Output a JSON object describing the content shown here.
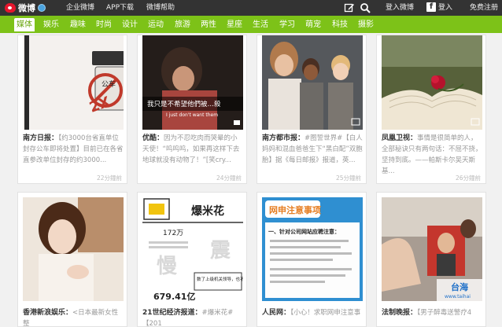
{
  "topbar": {
    "logo_text": "微博",
    "nav": [
      "企业微博",
      "APP下载",
      "微博帮助"
    ],
    "login_weibo": "登入微博",
    "login_fb": "登入",
    "register": "免费注册",
    "fb_letter": "f"
  },
  "categories": [
    "媒体",
    "娱乐",
    "趣味",
    "时尚",
    "设计",
    "运动",
    "旅游",
    "两性",
    "星座",
    "生活",
    "学习",
    "萌宠",
    "科技",
    "摄影"
  ],
  "cards_row1": [
    {
      "source": "南方日报：",
      "text": "【约3000台省直单位封存公车即将处置】目前已在各省直参改单位封存的约3000...",
      "time": "22分鐘前"
    },
    {
      "source": "优酷：",
      "text": "因为不忍吃肉而哭晕的小天使！“呜呜呜，如果再这样下去地球就没有动物了！”[笑cry...",
      "time": "24分鐘前"
    },
    {
      "source": "南方都市报：",
      "text": "#图誓世界#【白人妈妈和混血爸爸生下“黑白配”双胞胎】据《每日邮报》报道，英...",
      "time": "25分鐘前"
    },
    {
      "source": "凤凰卫视：",
      "text": "事情是很简单的人，全部秘诀只有两句话：不屈不挠，坚持到底。——帕斯卡尔吴天斯基...",
      "time": "26分鐘前"
    }
  ],
  "cards_row2": [
    {
      "source": "香港新浪娱乐：",
      "text": "<日本最新女性整"
    },
    {
      "source": "21世纪经济报道：",
      "text": "#爆米花#【201"
    },
    {
      "source": "人民网：",
      "text": "【小心！求职网申注意事"
    },
    {
      "source": "法制晚报：",
      "text": "【男子醉毒送警疗4"
    }
  ],
  "image_texts": {
    "card1_sign": "公车",
    "card1_stamp": "2X",
    "card2_sub1": "我只是不希望他們被…殺",
    "card2_sub2": "I just don't want them",
    "card6_title": "爆米花",
    "card6_num1": "172万",
    "card6_num2": "679.41亿",
    "card6_big1": "慢",
    "card6_big2": "震",
    "card6_box": "数了上级机关领导，也不能叫家属",
    "card7_title": "网申注意事项",
    "card7_line": "一、针对公司网站应聘注意：",
    "card8_logo": "台海",
    "card8_url": "www.taihai"
  }
}
